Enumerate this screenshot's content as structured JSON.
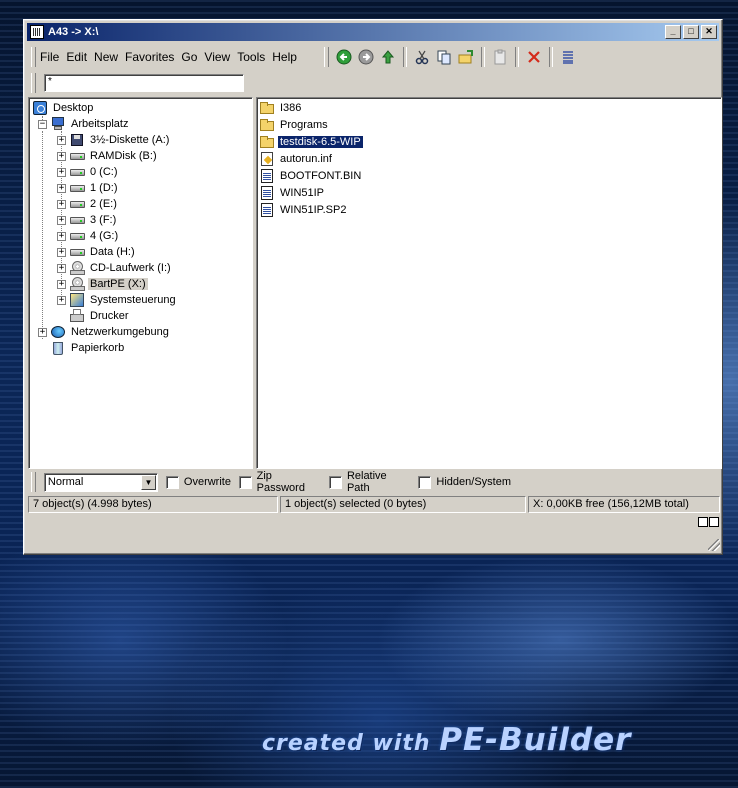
{
  "window": {
    "title": "A43 -> X:\\"
  },
  "menu": [
    "File",
    "Edit",
    "New",
    "Favorites",
    "Go",
    "View",
    "Tools",
    "Help"
  ],
  "toolbar_icons": [
    "back-icon",
    "forward-icon",
    "up-icon",
    "cut-icon",
    "copy-icon",
    "paste-folder-icon",
    "clipboard-icon",
    "delete-icon",
    "view-icon"
  ],
  "address": {
    "value": "*"
  },
  "tree": {
    "desktop": "Desktop",
    "arbeitsplatz": "Arbeitsplatz",
    "drives": [
      {
        "label": "3½-Diskette (A:)",
        "icon": "floppy"
      },
      {
        "label": "RAMDisk (B:)",
        "icon": "drive"
      },
      {
        "label": "0 (C:)",
        "icon": "drive"
      },
      {
        "label": "1 (D:)",
        "icon": "drive"
      },
      {
        "label": "2 (E:)",
        "icon": "drive"
      },
      {
        "label": "3 (F:)",
        "icon": "drive"
      },
      {
        "label": "4 (G:)",
        "icon": "drive"
      },
      {
        "label": "Data (H:)",
        "icon": "drive"
      },
      {
        "label": "CD-Laufwerk (I:)",
        "icon": "cdrom"
      },
      {
        "label": "BartPE (X:)",
        "icon": "cdrom"
      },
      {
        "label": "Systemsteuerung",
        "icon": "ctrl"
      }
    ],
    "drucker": "Drucker",
    "netzwerk": "Netzwerkumgebung",
    "papierkorb": "Papierkorb"
  },
  "files": [
    {
      "name": "I386",
      "icon": "folder"
    },
    {
      "name": "Programs",
      "icon": "folder"
    },
    {
      "name": "testdisk-6.5-WIP",
      "icon": "folder"
    },
    {
      "name": "autorun.inf",
      "icon": "inf"
    },
    {
      "name": "BOOTFONT.BIN",
      "icon": "binfile"
    },
    {
      "name": "WIN51IP",
      "icon": "binfile"
    },
    {
      "name": "WIN51IP.SP2",
      "icon": "binfile"
    }
  ],
  "options": {
    "mode": "Normal",
    "overwrite": "Overwrite",
    "zip_password": "Zip Password",
    "relative_path": "Relative Path",
    "hidden_system": "Hidden/System"
  },
  "status": {
    "objects": "7 object(s) (4.998 bytes)",
    "selected": "1 object(s) selected (0 bytes)",
    "free": "X: 0,00KB free (156,12MB total)"
  },
  "branding": {
    "part1": "created with ",
    "part2": "PE-Builder"
  }
}
